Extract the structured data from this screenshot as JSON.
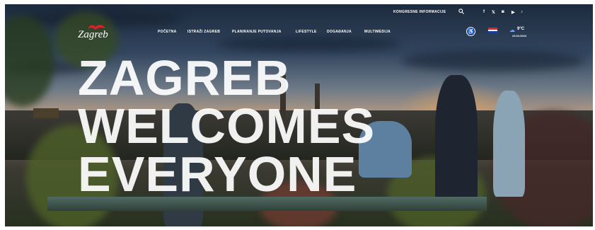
{
  "header": {
    "top_link": "KONGRESNE INFORMACIJE",
    "logo_text": "Zagreb",
    "social": [
      "f",
      "𝕏",
      "◙",
      "▶",
      "♪"
    ],
    "nav": [
      "POČETNA",
      "ISTRAŽI ZAGREB",
      "PLANIRANJE PUTOVANJA",
      "LIFESTYLE",
      "DOGAĐANJA",
      "MULTIMEDIJA"
    ],
    "accessibility_icon": "accessibility-icon",
    "language_flag": "croatia-flag",
    "weather": {
      "temperature": "9°C",
      "date": "23.04.2024"
    }
  },
  "hero": {
    "headline_lines": [
      "ZAGREB",
      "WELCOMES",
      "EVERYONE"
    ]
  },
  "colors": {
    "flag_red": "#e1262f",
    "flag_white": "#ffffff",
    "flag_blue": "#1b3f97",
    "logo_accent": "#d8232a"
  }
}
